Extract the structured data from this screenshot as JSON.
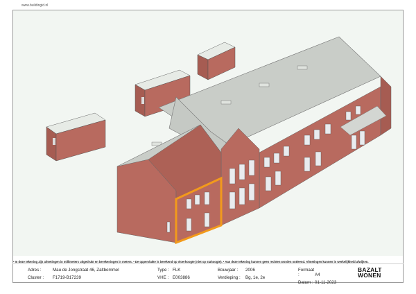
{
  "header": {
    "url": "www.buildingid.nl"
  },
  "disclaimer": "• In deze tekening zijn afmetingen in millimeters uitgedrukt en berekeningen in meters. • De oppervlakte is berekend op vloerhoogte (niet op stahoogte). • Aan deze tekening kunnen geen rechten worden ontleend. Afmetingen kunnen in werkelijkheid afwijken.",
  "info": {
    "adres_label": "Adres :",
    "adres_value": "Mau de Jongstraat 46, Zaltbommel",
    "cluster_label": "Cluster :",
    "cluster_value": "F1719-B17239",
    "type_label": "Type :",
    "type_value": "FLK",
    "vhe_label": "VHE :",
    "vhe_value": "E003886",
    "bouwjaar_label": "Bouwjaar :",
    "bouwjaar_value": "2006",
    "verdieping_label": "Verdieping :",
    "verdieping_value": "Bg, 1e, 2e",
    "formaat_label": "Formaat :",
    "formaat_value": "A4",
    "datum_label": "Datum :",
    "datum_value": "01-11-2023"
  },
  "logo": {
    "line1": "BAZALT",
    "line2": "WONEN"
  },
  "colors": {
    "brick": "#b86a5f",
    "brick_dark": "#9c5248",
    "roof": "#c9cdc8",
    "highlight": "#f29a1c",
    "background": "#f2f6f2"
  }
}
